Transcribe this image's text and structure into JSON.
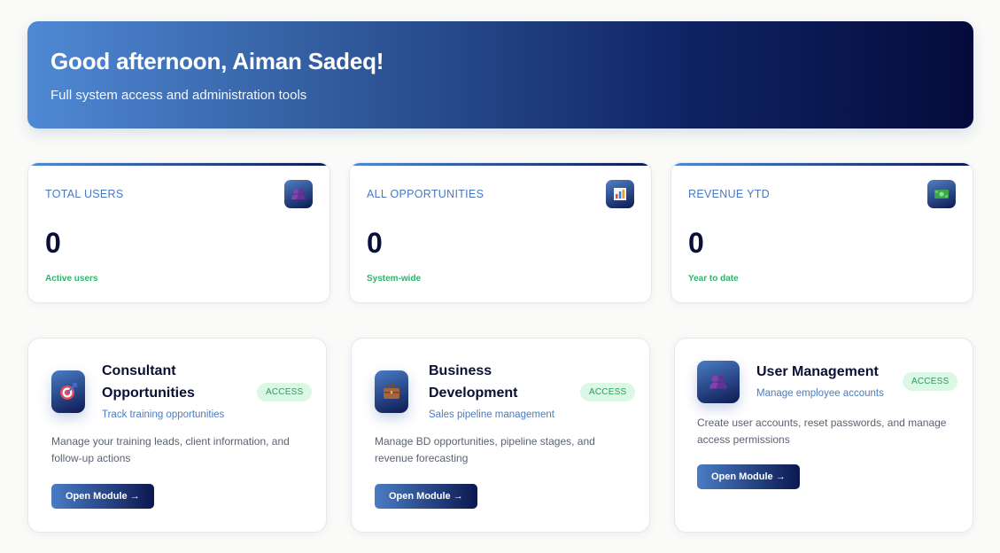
{
  "hero": {
    "greeting": "Good afternoon, Aiman Sadeq!",
    "subtitle": "Full system access and administration tools"
  },
  "stats": [
    {
      "label": "TOTAL USERS",
      "value": "0",
      "note": "Active users",
      "icon": "users-icon"
    },
    {
      "label": "ALL OPPORTUNITIES",
      "value": "0",
      "note": "System-wide",
      "icon": "bar-chart-icon"
    },
    {
      "label": "REVENUE YTD",
      "value": "0",
      "note": "Year to date",
      "icon": "money-icon"
    }
  ],
  "modules": [
    {
      "title_line1": "Consultant",
      "title_line2": "Opportunities",
      "subtitle": "Track training opportunities",
      "badge": "ACCESS",
      "description_line1": "Manage your training leads, client information, and",
      "description_line2": "follow-up actions",
      "button": "Open Module →",
      "icon": "target-icon"
    },
    {
      "title_line1": "Business",
      "title_line2": "Development",
      "subtitle": "Sales pipeline management",
      "badge": "ACCESS",
      "description_line1": "Manage BD opportunities, pipeline stages, and",
      "description_line2": "revenue forecasting",
      "button": "Open Module →",
      "icon": "briefcase-icon"
    },
    {
      "title_line1": "User Management",
      "subtitle": "Manage employee accounts",
      "badge": "ACCESS",
      "description_line1": "Create user accounts, reset passwords, and manage",
      "description_line2": "access permissions",
      "button": "Open Module →",
      "icon": "users-icon"
    }
  ],
  "colors": {
    "accent_green": "#2fb36a",
    "accent_blue": "#4a78c0",
    "navy": "#0a0f3a"
  }
}
